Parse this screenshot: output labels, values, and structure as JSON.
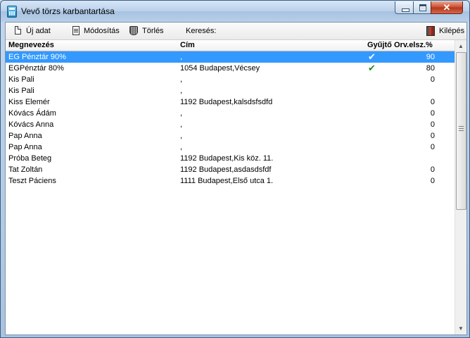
{
  "window": {
    "title": "Vevő törzs karbantartása",
    "close_glyph": "✕"
  },
  "toolbar": {
    "new_label": "Új adat",
    "edit_label": "Módosítás",
    "delete_label": "Törlés",
    "search_label": "Keresés:",
    "exit_label": "Kilépés",
    "icons": {
      "new": "new-document-icon",
      "edit": "edit-document-icon",
      "delete": "trash-icon",
      "exit": "exit-door-icon"
    }
  },
  "list": {
    "columns": {
      "name": "Megnevezés",
      "address": "Cím",
      "collector": "Gyűjtő",
      "discount": "Orv.elsz.%"
    },
    "check_glyph": "✔",
    "rows": [
      {
        "name": "EG Pénztár 90%",
        "address": ",",
        "collector": true,
        "discount": "90",
        "selected": true
      },
      {
        "name": "EGPénztár 80%",
        "address": "1054 Budapest,Vécsey",
        "collector": true,
        "discount": "80"
      },
      {
        "name": "Kis Pali",
        "address": ",",
        "collector": false,
        "discount": "0"
      },
      {
        "name": "Kis Pali",
        "address": ",",
        "collector": false,
        "discount": ""
      },
      {
        "name": "Kiss Elemér",
        "address": "1192 Budapest,kalsdsfsdfd",
        "collector": false,
        "discount": "0"
      },
      {
        "name": "Kóvács Ádám",
        "address": ",",
        "collector": false,
        "discount": "0"
      },
      {
        "name": "Kóvács Anna",
        "address": ",",
        "collector": false,
        "discount": "0"
      },
      {
        "name": "Pap Anna",
        "address": ",",
        "collector": false,
        "discount": "0"
      },
      {
        "name": "Pap Anna",
        "address": ",",
        "collector": false,
        "discount": "0"
      },
      {
        "name": "Próba Beteg",
        "address": "1192 Budapest,Kis köz. 11.",
        "collector": false,
        "discount": ""
      },
      {
        "name": "Tat Zoltán",
        "address": "1192 Budapest,asdasdsfdf",
        "collector": false,
        "discount": "0"
      },
      {
        "name": "Teszt Páciens",
        "address": "1111 Budapest,Első utca 1.",
        "collector": false,
        "discount": "0"
      }
    ]
  },
  "scrollbar": {
    "up_glyph": "▲",
    "down_glyph": "▼"
  },
  "colors": {
    "selection": "#3399ff",
    "check": "#1f8a1f"
  }
}
